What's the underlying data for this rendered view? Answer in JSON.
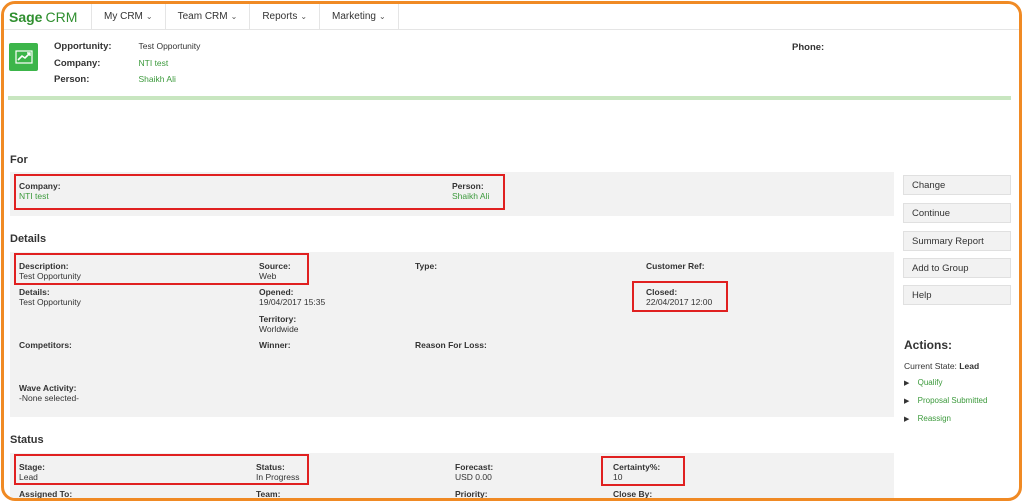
{
  "nav": {
    "brand_sage": "Sage",
    "brand_crm": "CRM",
    "items": [
      {
        "label": "My CRM"
      },
      {
        "label": "Team CRM"
      },
      {
        "label": "Reports"
      },
      {
        "label": "Marketing"
      }
    ]
  },
  "header": {
    "opportunity_label": "Opportunity:",
    "opportunity_value": "Test Opportunity",
    "company_label": "Company:",
    "company_value": "NTI test",
    "person_label": "Person:",
    "person_value": "Shaikh Ali",
    "phone_label": "Phone:"
  },
  "for_section": {
    "title": "For",
    "company_label": "Company:",
    "company_value": "NTI test",
    "person_label": "Person:",
    "person_value": "Shaikh Ali"
  },
  "details": {
    "title": "Details",
    "description_label": "Description:",
    "description_value": "Test Opportunity",
    "source_label": "Source:",
    "source_value": "Web",
    "type_label": "Type:",
    "customer_ref_label": "Customer Ref:",
    "details_label": "Details:",
    "details_value": "Test Opportunity",
    "opened_label": "Opened:",
    "opened_value": "19/04/2017 15:35",
    "closed_label": "Closed:",
    "closed_value": "22/04/2017 12:00",
    "territory_label": "Territory:",
    "territory_value": "Worldwide",
    "competitors_label": "Competitors:",
    "winner_label": "Winner:",
    "reason_label": "Reason For Loss:",
    "wave_label": "Wave Activity:",
    "wave_value": "-None selected-"
  },
  "status": {
    "title": "Status",
    "stage_label": "Stage:",
    "stage_value": "Lead",
    "status_label": "Status:",
    "status_value": "In Progress",
    "forecast_label": "Forecast:",
    "forecast_value": "USD 0.00",
    "certainty_label": "Certainty%:",
    "certainty_value": "10",
    "assigned_label": "Assigned To:",
    "team_label": "Team:",
    "priority_label": "Priority:",
    "closeby_label": "Close By:"
  },
  "buttons": {
    "change": "Change",
    "continue": "Continue",
    "summary_report": "Summary Report",
    "add_to_group": "Add to Group",
    "help": "Help"
  },
  "actions": {
    "title": "Actions:",
    "current_state_label": "Current State:",
    "current_state_value": "Lead",
    "items": [
      {
        "label": "Qualify"
      },
      {
        "label": "Proposal Submitted"
      },
      {
        "label": "Reassign"
      }
    ]
  },
  "colors": {
    "accent_green": "#3c9a3c",
    "frame_orange": "#f08a24",
    "highlight_red": "#e02020"
  },
  "icons": {
    "opportunity": "trend-chart-icon",
    "nav_dropdown": "chevron-down-icon",
    "action_bullet": "triangle-right-icon"
  }
}
